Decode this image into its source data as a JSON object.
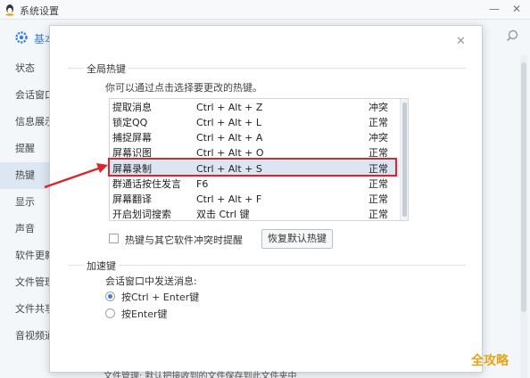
{
  "window": {
    "title": "系统设置"
  },
  "header": {
    "basic_label": "基本"
  },
  "sidebar": {
    "items": [
      {
        "label": "状态"
      },
      {
        "label": "会话窗口"
      },
      {
        "label": "信息展示"
      },
      {
        "label": "提醒"
      },
      {
        "label": "热键"
      },
      {
        "label": "显示"
      },
      {
        "label": "声音"
      },
      {
        "label": "软件更新"
      },
      {
        "label": "文件管理"
      },
      {
        "label": "文件共享"
      },
      {
        "label": "音视频通话"
      }
    ]
  },
  "dialog": {
    "global_group_title": "全局热键",
    "hint": "你可以通过点击选择要更改的热键。",
    "hotkeys": [
      {
        "name": "提取消息",
        "key": "Ctrl + Alt + Z",
        "status": "冲突"
      },
      {
        "name": "锁定QQ",
        "key": "Ctrl + Alt + L",
        "status": "正常"
      },
      {
        "name": "捕捉屏幕",
        "key": "Ctrl + Alt + A",
        "status": "冲突"
      },
      {
        "name": "屏幕识图",
        "key": "Ctrl + Alt + O",
        "status": "正常"
      },
      {
        "name": "屏幕录制",
        "key": "Ctrl + Alt + S",
        "status": "正常"
      },
      {
        "name": "群通话按住发言",
        "key": "F6",
        "status": "正常"
      },
      {
        "name": "屏幕翻译",
        "key": "Ctrl + Alt + F",
        "status": "正常"
      },
      {
        "name": "开启划词搜索",
        "key": "双击 Ctrl 键",
        "status": "正常"
      }
    ],
    "conflict_checkbox_label": "热键与其它软件冲突时提醒",
    "restore_button": "恢复默认热键",
    "accel_group_title": "加速键",
    "send_label": "会话窗口中发送消息:",
    "radio_options": [
      {
        "label": "按Ctrl + Enter键",
        "checked": true
      },
      {
        "label": "按Enter键",
        "checked": false
      }
    ],
    "cut_text": "文件管理:    默认把接收到的文件保存到此文件夹中"
  },
  "watermark": "全攻略",
  "colors": {
    "accent": "#3a7fd1",
    "highlight": "#d9252c",
    "watermark": "#e5a21a"
  }
}
